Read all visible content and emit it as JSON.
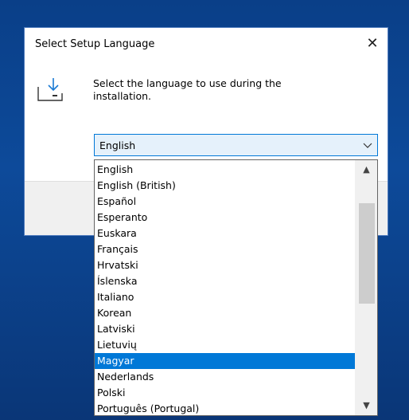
{
  "dialog": {
    "title": "Select Setup Language",
    "close_glyph": "✕",
    "message": "Select the language to use during the installation.",
    "icon": "install-download-icon"
  },
  "language_select": {
    "value": "English",
    "chevron": "chevron-down-icon"
  },
  "language_list": {
    "items": [
      "English",
      "English (British)",
      "Español",
      "Esperanto",
      "Euskara",
      "Français",
      "Hrvatski",
      "Íslenska",
      "Italiano",
      "Korean",
      "Latviski",
      "Lietuvių",
      "Magyar",
      "Nederlands",
      "Polski",
      "Português (Portugal)"
    ],
    "highlighted": "Magyar",
    "scroll_up_glyph": "▲",
    "scroll_down_glyph": "▼"
  },
  "colors": {
    "accent": "#0078d7",
    "dialog_border": "#4f7bbd",
    "desktop": "#0d4a9a"
  }
}
